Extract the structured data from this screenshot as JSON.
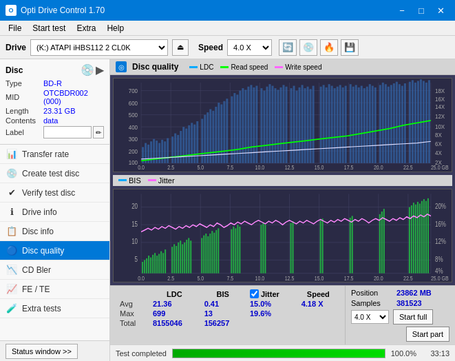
{
  "titlebar": {
    "title": "Opti Drive Control 1.70",
    "icon_text": "O",
    "minimize": "−",
    "maximize": "□",
    "close": "✕"
  },
  "menubar": {
    "items": [
      "File",
      "Start test",
      "Extra",
      "Help"
    ]
  },
  "toolbar": {
    "drive_label": "Drive",
    "drive_value": "(K:)  ATAPI iHBS112  2 CL0K",
    "speed_label": "Speed",
    "speed_value": "4.0 X"
  },
  "sidebar": {
    "disc_title": "Disc",
    "disc_fields": {
      "type_label": "Type",
      "type_value": "BD-R",
      "mid_label": "MID",
      "mid_value": "OTCBDR002 (000)",
      "length_label": "Length",
      "length_value": "23.31 GB",
      "contents_label": "Contents",
      "contents_value": "data",
      "label_label": "Label"
    },
    "menu_items": [
      {
        "id": "transfer-rate",
        "label": "Transfer rate",
        "icon": "📊"
      },
      {
        "id": "create-test-disc",
        "label": "Create test disc",
        "icon": "💿"
      },
      {
        "id": "verify-test-disc",
        "label": "Verify test disc",
        "icon": "✔"
      },
      {
        "id": "drive-info",
        "label": "Drive info",
        "icon": "ℹ"
      },
      {
        "id": "disc-info",
        "label": "Disc info",
        "icon": "📋"
      },
      {
        "id": "disc-quality",
        "label": "Disc quality",
        "icon": "🔵",
        "active": true
      },
      {
        "id": "cd-bler",
        "label": "CD Bler",
        "icon": "📉"
      },
      {
        "id": "fe-te",
        "label": "FE / TE",
        "icon": "📈"
      },
      {
        "id": "extra-tests",
        "label": "Extra tests",
        "icon": "🧪"
      }
    ],
    "status_btn": "Status window >>"
  },
  "chart": {
    "title": "Disc quality",
    "legend": [
      {
        "label": "LDC",
        "color": "#00aaff"
      },
      {
        "label": "Read speed",
        "color": "#00ff00"
      },
      {
        "label": "Write speed",
        "color": "#ff66ff"
      }
    ],
    "legend2": [
      {
        "label": "BIS",
        "color": "#00aaff"
      },
      {
        "label": "Jitter",
        "color": "#ff66ff"
      }
    ],
    "top_y_labels": [
      "700",
      "600",
      "500",
      "400",
      "300",
      "200",
      "100"
    ],
    "top_y_right": [
      "18X",
      "16X",
      "14X",
      "12X",
      "10X",
      "8X",
      "6X",
      "4X",
      "2X"
    ],
    "x_labels": [
      "0.0",
      "2.5",
      "5.0",
      "7.5",
      "10.0",
      "12.5",
      "15.0",
      "17.5",
      "20.0",
      "22.5",
      "25.0 GB"
    ],
    "bot_y_labels": [
      "20",
      "15",
      "10",
      "5"
    ],
    "bot_y_right": [
      "20%",
      "16%",
      "12%",
      "8%",
      "4%"
    ]
  },
  "stats": {
    "col_ldc": "LDC",
    "col_bis": "BIS",
    "col_jitter": "Jitter",
    "col_speed": "Speed",
    "row_avg": "Avg",
    "row_max": "Max",
    "row_total": "Total",
    "avg_ldc": "21.36",
    "avg_bis": "0.41",
    "avg_jitter": "15.0%",
    "avg_speed": "4.18 X",
    "max_ldc": "699",
    "max_bis": "13",
    "max_jitter": "19.6%",
    "total_ldc": "8155046",
    "total_bis": "156257",
    "position_label": "Position",
    "position_value": "23862 MB",
    "samples_label": "Samples",
    "samples_value": "381523",
    "speed_select": "4.0 X",
    "start_full_btn": "Start full",
    "start_part_btn": "Start part"
  },
  "bottombar": {
    "status_text": "Test completed",
    "progress": "100.0%",
    "time": "33:13"
  }
}
